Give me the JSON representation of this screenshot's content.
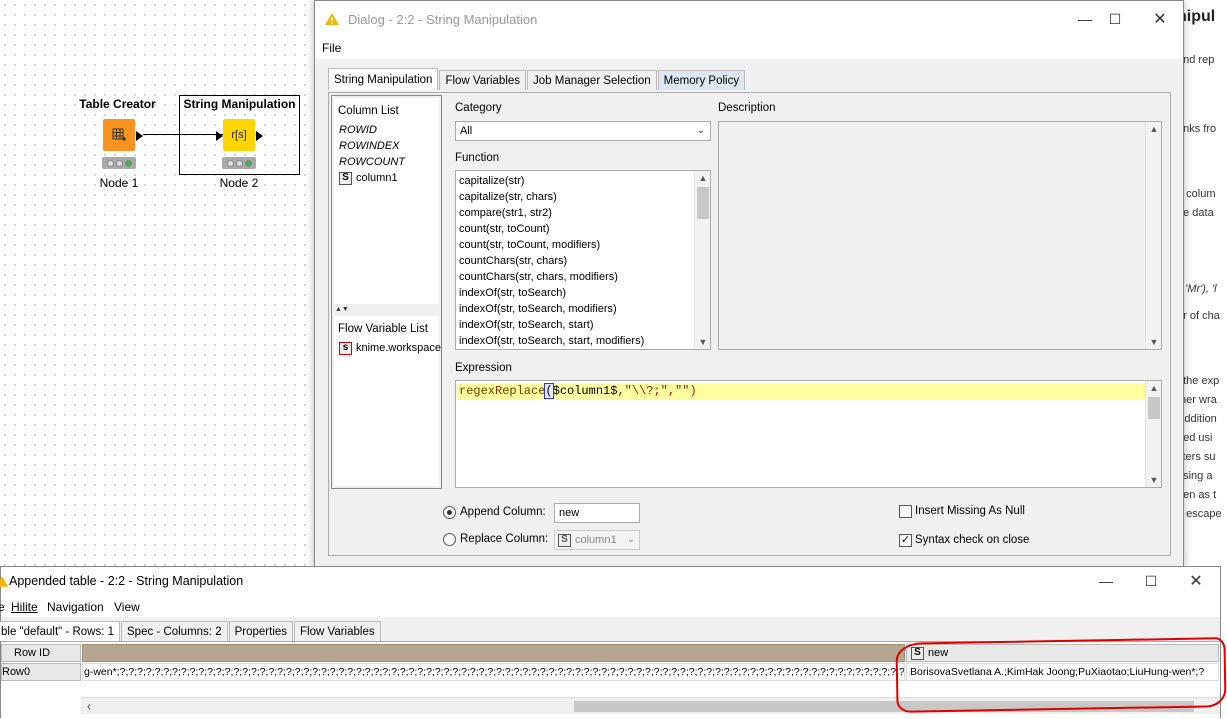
{
  "workflow": {
    "nodes": [
      {
        "title": "Table Creator",
        "label": "Node 1"
      },
      {
        "title": "String Manipulation",
        "label": "Node 2",
        "icon_text": "r[s]"
      }
    ]
  },
  "description_panel": {
    "heading": "nipul",
    "lines": [
      "and rep",
      "anks fro",
      "n colum",
      "he data",
      "', 'Mr'), 'l",
      "er of cha",
      "f the exp",
      "ther wra",
      "Addition",
      "ped usi",
      "cters su",
      "using a",
      "tten as t",
      "e escape"
    ]
  },
  "dialog": {
    "title": "Dialog - 2:2 - String Manipulation",
    "menu": [
      "File"
    ],
    "tabs": [
      "String Manipulation",
      "Flow Variables",
      "Job Manager Selection",
      "Memory Policy"
    ],
    "column_list": {
      "label": "Column List",
      "items": [
        "ROWID",
        "ROWINDEX",
        "ROWCOUNT",
        "column1"
      ]
    },
    "flow_variable_list": {
      "label": "Flow Variable List",
      "items": [
        "knime.workspace"
      ]
    },
    "category": {
      "label": "Category",
      "value": "All"
    },
    "function": {
      "label": "Function",
      "items": [
        "capitalize(str)",
        "capitalize(str, chars)",
        "compare(str1, str2)",
        "count(str, toCount)",
        "count(str, toCount, modifiers)",
        "countChars(str, chars)",
        "countChars(str, chars, modifiers)",
        "indexOf(str, toSearch)",
        "indexOf(str, toSearch, modifiers)",
        "indexOf(str, toSearch, start)",
        "indexOf(str, toSearch, start, modifiers)"
      ]
    },
    "description_label": "Description",
    "expression": {
      "label": "Expression",
      "fn": "regexReplace",
      "paren": "(",
      "col": "$column1$",
      "args": ",\"\\\\?;\",\"\")"
    },
    "append_column": {
      "label": "Append Column:",
      "value": "new"
    },
    "replace_column": {
      "label": "Replace Column:",
      "value": "column1"
    },
    "insert_missing": {
      "label": "Insert Missing As Null",
      "checked": false
    },
    "syntax_check": {
      "label": "Syntax check on close",
      "checked": true
    }
  },
  "table_window": {
    "title": "Appended table - 2:2 - String Manipulation",
    "menu": [
      "Hilite",
      "Navigation",
      "View"
    ],
    "tabs": [
      "ble \"default\" - Rows: 1",
      "Spec - Columns: 2",
      "Properties",
      "Flow Variables"
    ],
    "headers": {
      "row_id": "Row ID",
      "new": "new"
    },
    "rows": [
      {
        "id": "Row0",
        "column1": "g-wen*;?;?;?;?;?;?;?;?;?;?;?;?;?;?;?;?;?;?;?;?;?;?;?;?;?;?;?;?;?;?;?;?;?;?;?;?;?;?;?;?;?;?;?;?;?;?;?;?;?;?;?;?;?;?;?;?;?;?;?;?;?;?;?;?;?;?;?;?;?;?;?;?;?;?;?;?;?;?;?;?;?;?;?;?;?;?;?;?;?;?;?;?",
        "new": "BorisovaSvetlana A.;KimHak Joong;PuXiaotao;LiuHung-wen*;?"
      }
    ]
  },
  "colors": {
    "accent_orange": "#f7931e",
    "node_yellow": "#ffd500",
    "highlight_yellow": "#ffffa0",
    "annotation_red": "#e00000"
  }
}
